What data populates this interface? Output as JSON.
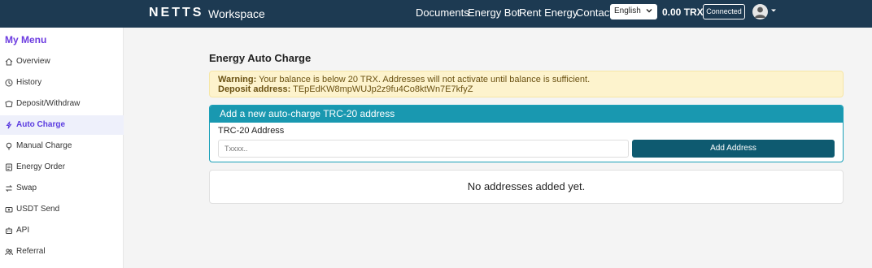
{
  "header": {
    "logo": "NETTS",
    "brand_sub": "Workspace",
    "nav": [
      "Documents",
      "Energy Bot",
      "Rent Energy",
      "Contact"
    ],
    "language": "English",
    "balance": "0.00 TRX",
    "status": "Connected"
  },
  "sidebar": {
    "title": "My Menu",
    "items": [
      {
        "label": "Overview",
        "icon": "home-icon",
        "active": false
      },
      {
        "label": "History",
        "icon": "clock-icon",
        "active": false
      },
      {
        "label": "Deposit/Withdraw",
        "icon": "wallet-icon",
        "active": false
      },
      {
        "label": "Auto Charge",
        "icon": "lightning-icon",
        "active": true
      },
      {
        "label": "Manual Charge",
        "icon": "bulb-icon",
        "active": false
      },
      {
        "label": "Energy Order",
        "icon": "order-icon",
        "active": false
      },
      {
        "label": "Swap",
        "icon": "swap-icon",
        "active": false
      },
      {
        "label": "USDT Send",
        "icon": "send-icon",
        "active": false
      },
      {
        "label": "API",
        "icon": "robot-icon",
        "active": false
      },
      {
        "label": "Referral",
        "icon": "people-icon",
        "active": false
      }
    ]
  },
  "main": {
    "title": "Energy Auto Charge",
    "warning": {
      "label": "Warning:",
      "text": " Your balance is below 20 TRX. Addresses will not activate until balance is sufficient.",
      "deposit_label": "Deposit address:",
      "deposit_address": " TEpEdKW8mpWUJp2z9fu4Co8ktWn7E7kfyZ"
    },
    "card": {
      "header": "Add a new auto-charge TRC-20 address",
      "field_label": "TRC-20 Address",
      "placeholder": "Txxxx..",
      "button": "Add Address"
    },
    "empty_text": "No addresses added yet."
  },
  "colors": {
    "navbar": "#1d3a52",
    "accent_purple": "#6c3be0",
    "card_header": "#1998b0",
    "button": "#0e5a70",
    "warning_bg": "#fdf3cd"
  }
}
